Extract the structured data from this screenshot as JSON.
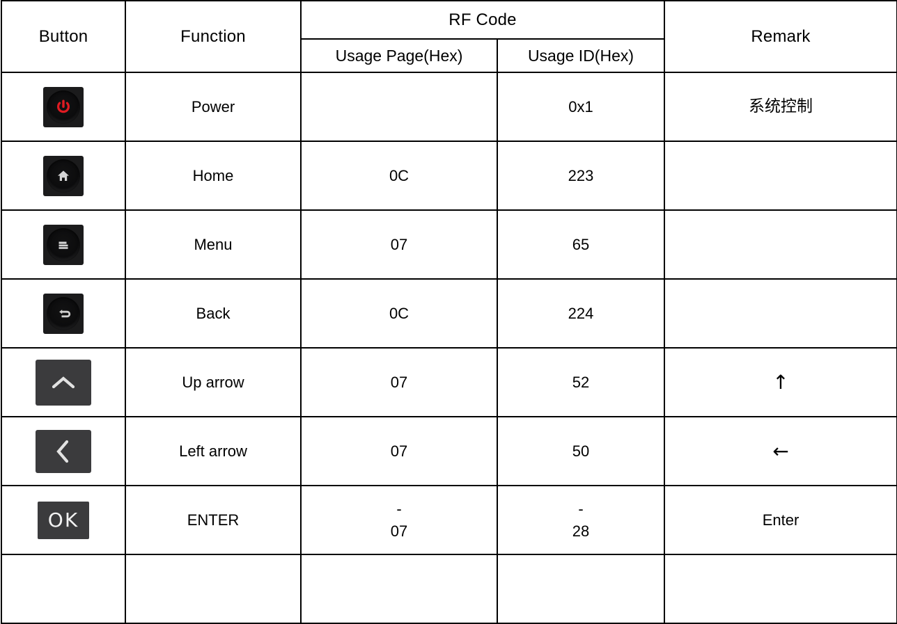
{
  "table": {
    "headers": {
      "button": "Button",
      "function": "Function",
      "rf_code": "RF Code",
      "usage_page": "Usage Page(Hex)",
      "usage_id": "Usage ID(Hex)",
      "remark": "Remark"
    },
    "rows": [
      {
        "icon": "power-icon",
        "function": "Power",
        "usage_page": "",
        "usage_id": "0x1",
        "remark": "系统控制"
      },
      {
        "icon": "home-icon",
        "function": "Home",
        "usage_page": "0C",
        "usage_id": "223",
        "remark": ""
      },
      {
        "icon": "menu-icon",
        "function": "Menu",
        "usage_page": "07",
        "usage_id": "65",
        "remark": ""
      },
      {
        "icon": "back-icon",
        "function": "Back",
        "usage_page": "0C",
        "usage_id": "224",
        "remark": ""
      },
      {
        "icon": "up-arrow-icon",
        "function": "Up arrow",
        "usage_page": "07",
        "usage_id": "52",
        "remark": "↑"
      },
      {
        "icon": "left-arrow-icon",
        "function": "Left arrow",
        "usage_page": "07",
        "usage_id": "50",
        "remark": "←"
      },
      {
        "icon": "ok-icon",
        "function": "ENTER",
        "usage_page_line1": "-",
        "usage_page": "07",
        "usage_id_line1": "-",
        "usage_id": "28",
        "remark": "Enter"
      }
    ]
  },
  "colors": {
    "border": "#000000",
    "background": "#ffffff",
    "text": "#000000",
    "key_dark": "#1b1b1c",
    "key_gray": "#3b3b3d",
    "power_red": "#e01b22",
    "glyph_white": "#d8d8d8"
  }
}
